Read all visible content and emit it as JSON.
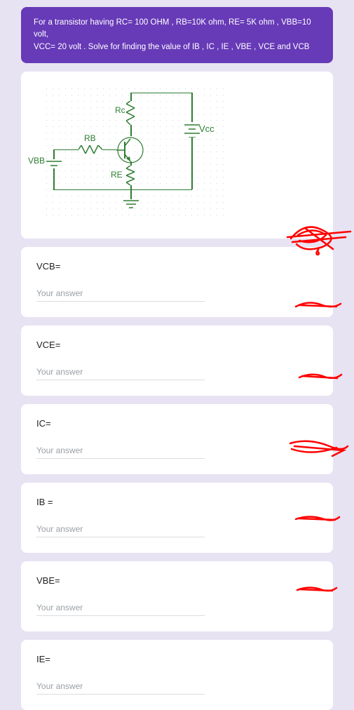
{
  "header": {
    "line1": "For a transistor having RC= 100 OHM , RB=10K ohm, RE= 5K ohm , VBB=10 volt,",
    "line2": "VCC= 20 volt . Solve for finding the value of IB , IC , IE , VBE , VCE and VCB"
  },
  "circuit": {
    "labels": {
      "Rc": "Rc",
      "RB": "RB",
      "RE": "RE",
      "VBB": "VBB",
      "Vcc": "Vcc"
    }
  },
  "questions": [
    {
      "label": "VCB=",
      "placeholder": "Your answer"
    },
    {
      "label": "VCE=",
      "placeholder": "Your answer"
    },
    {
      "label": "IC=",
      "placeholder": "Your answer"
    },
    {
      "label": "IB =",
      "placeholder": "Your answer"
    },
    {
      "label": "VBE=",
      "placeholder": "Your answer"
    },
    {
      "label": "IE=",
      "placeholder": "Your answer"
    }
  ]
}
